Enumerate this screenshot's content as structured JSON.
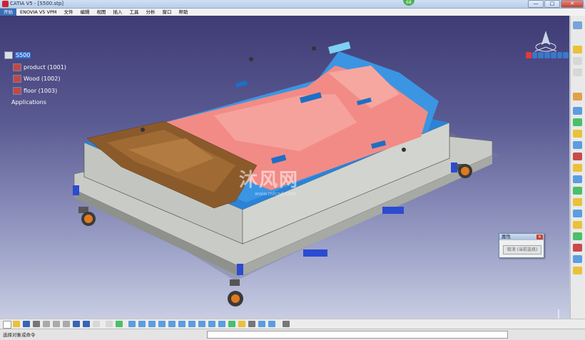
{
  "window": {
    "title": "CATIA V5 - [S500.stp]",
    "controls": {
      "minimize": "—",
      "maximize": "□",
      "close": "✕"
    },
    "badge": "68"
  },
  "menu": {
    "items": [
      "开始",
      "ENOVIA V5 VPM",
      "文件",
      "编辑",
      "视图",
      "插入",
      "工具",
      "分析",
      "窗口",
      "帮助"
    ]
  },
  "tree": {
    "root": "S500",
    "children": [
      "product (1001)",
      "Wood (1002)",
      "floor (1003)"
    ],
    "applications": "Applications"
  },
  "watermark": {
    "text": "沐风网",
    "url": "www.mfcad.com"
  },
  "dialog": {
    "title": "属性",
    "button": "取消 (当前选择)",
    "close": "✕"
  },
  "status": {
    "prompt": "选择对象或命令"
  },
  "colors": {
    "viewport_top": "#3f3b74",
    "viewport_bottom": "#c8cde3",
    "mold_pink": "#f28b86",
    "mold_blue": "#2a83d6",
    "wood_brown": "#8b5a2b",
    "base_grey": "#d9dbd6",
    "selection": "#2f6fd4"
  }
}
